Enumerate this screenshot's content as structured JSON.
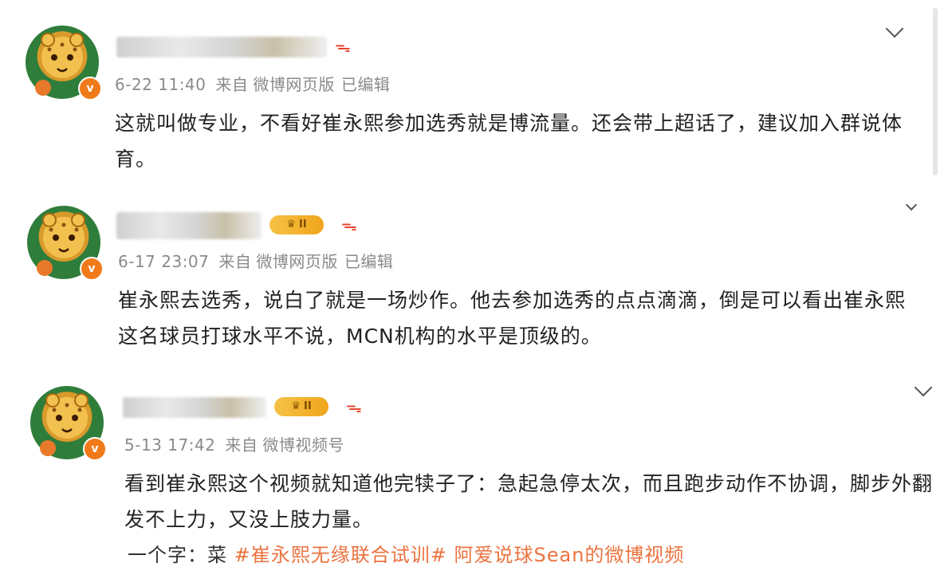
{
  "posts": [
    {
      "badge": "",
      "meta": {
        "date": "6-22 11:40",
        "from": "来自",
        "source": "微博网页版",
        "edited": "已编辑"
      },
      "content": "这就叫做专业，不看好崔永熙参加选秀就是博流量。还会带上超话了，建议加入群说体育。"
    },
    {
      "badge": "II",
      "meta": {
        "date": "6-17 23:07",
        "from": "来自",
        "source": "微博网页版",
        "edited": "已编辑"
      },
      "content": "崔永熙去选秀，说白了就是一场炒作。他去参加选秀的点点滴滴，倒是可以看出崔永熙这名球员打球水平不说，MCN机构的水平是顶级的。"
    },
    {
      "badge": "II",
      "meta": {
        "date": "5-13 17:42",
        "from": "来自",
        "source": "微博视频号",
        "edited": ""
      },
      "content": "看到崔永熙这个视频就知道他完犊子了：急起急停太次，而且跑步动作不协调，脚步外翻发不上力，又没上肢力量。"
    }
  ],
  "partial": {
    "prefix": "一个字：菜",
    "topic": "#崔永熙无缘联合试训#",
    "link": "阿爱说球Sean的微博视频"
  },
  "colors": {
    "meta_text": "#8a8a8a",
    "verified": "#f07a1a",
    "badge": "#f5c246",
    "fire": "#e8442e",
    "topic": "#eb7340"
  }
}
